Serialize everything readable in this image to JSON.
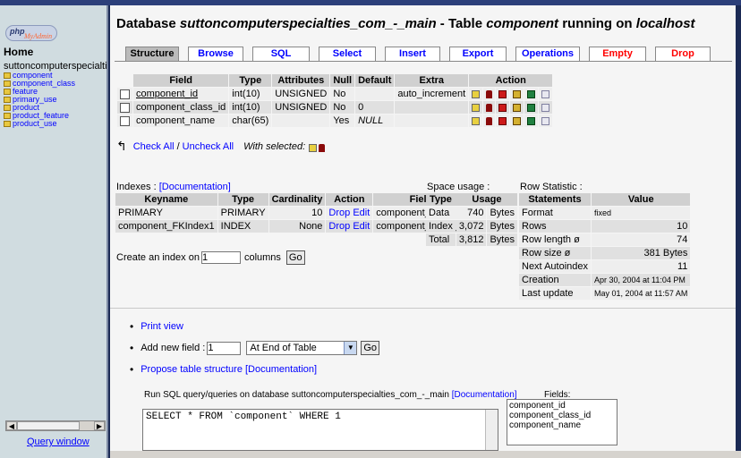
{
  "sidebar": {
    "home": "Home",
    "db_name": "suttoncomputerspecialties_com_-_main",
    "tables": [
      "component",
      "component_class",
      "feature",
      "primary_use",
      "product",
      "product_feature",
      "product_use"
    ],
    "query_window": "Query window"
  },
  "header": {
    "prefix": "Database ",
    "db": "suttoncomputerspecialties_com_-_main",
    "mid": " - Table ",
    "table": "component",
    "suffix": " running on ",
    "host": "localhost"
  },
  "tabs": [
    "Structure",
    "Browse",
    "SQL",
    "Select",
    "Insert",
    "Export",
    "Operations",
    "Empty",
    "Drop"
  ],
  "fields_table": {
    "headers": [
      "Field",
      "Type",
      "Attributes",
      "Null",
      "Default",
      "Extra",
      "Action"
    ],
    "rows": [
      {
        "field": "component_id",
        "type": "int(10)",
        "attributes": "UNSIGNED",
        "null": "No",
        "default": "",
        "extra": "auto_increment"
      },
      {
        "field": "component_class_id",
        "type": "int(10)",
        "attributes": "UNSIGNED",
        "null": "No",
        "default": "0",
        "extra": ""
      },
      {
        "field": "component_name",
        "type": "char(65)",
        "attributes": "",
        "null": "Yes",
        "default": "NULL",
        "extra": ""
      }
    ]
  },
  "checkall": {
    "check_all": "Check All",
    "sep": "/",
    "uncheck_all": "Uncheck All",
    "with_selected": "With selected:"
  },
  "indexes": {
    "label": "Indexes : ",
    "doc": "[Documentation]",
    "headers": [
      "Keyname",
      "Type",
      "Cardinality",
      "Action",
      "Field"
    ],
    "rows": [
      {
        "keyname": "PRIMARY",
        "type": "PRIMARY",
        "cardinality": "10",
        "field": "component_id"
      },
      {
        "keyname": "component_FKIndex1",
        "type": "INDEX",
        "cardinality": "None",
        "field": "component_class_id"
      }
    ],
    "drop": "Drop",
    "edit": "Edit",
    "create_prefix": "Create an index on",
    "create_value": "1",
    "create_suffix": "columns",
    "go": "Go"
  },
  "space": {
    "label": "Space usage :",
    "headers": [
      "Type",
      "Usage"
    ],
    "rows": [
      {
        "type": "Data",
        "value": "740",
        "unit": "Bytes"
      },
      {
        "type": "Index",
        "value": "3,072",
        "unit": "Bytes"
      },
      {
        "type": "Total",
        "value": "3,812",
        "unit": "Bytes"
      }
    ]
  },
  "rowstat": {
    "label": "Row Statistic :",
    "headers": [
      "Statements",
      "Value"
    ],
    "rows": [
      {
        "k": "Format",
        "v": "fixed"
      },
      {
        "k": "Rows",
        "v": "10"
      },
      {
        "k": "Row length ø",
        "v": "74"
      },
      {
        "k": "Row size  ø",
        "v": "381 Bytes"
      },
      {
        "k": "Next Autoindex",
        "v": "11"
      },
      {
        "k": "Creation",
        "v": "Apr 30, 2004 at 11:04 PM"
      },
      {
        "k": "Last update",
        "v": "May 01, 2004 at 11:57 AM"
      }
    ]
  },
  "links": {
    "print_view": "Print view",
    "add_field": "Add new field :",
    "add_field_value": "1",
    "position": "At End of Table",
    "go": "Go",
    "propose": "Propose table structure",
    "doc": "[Documentation]"
  },
  "sql": {
    "label_prefix": "Run SQL query/queries on database suttoncomputerspecialties_com_-_main ",
    "doc": "[Documentation]",
    "query": "SELECT * FROM `component` WHERE 1",
    "fields_label": "Fields:",
    "fields": [
      "component_id",
      "component_class_id",
      "component_name"
    ]
  }
}
